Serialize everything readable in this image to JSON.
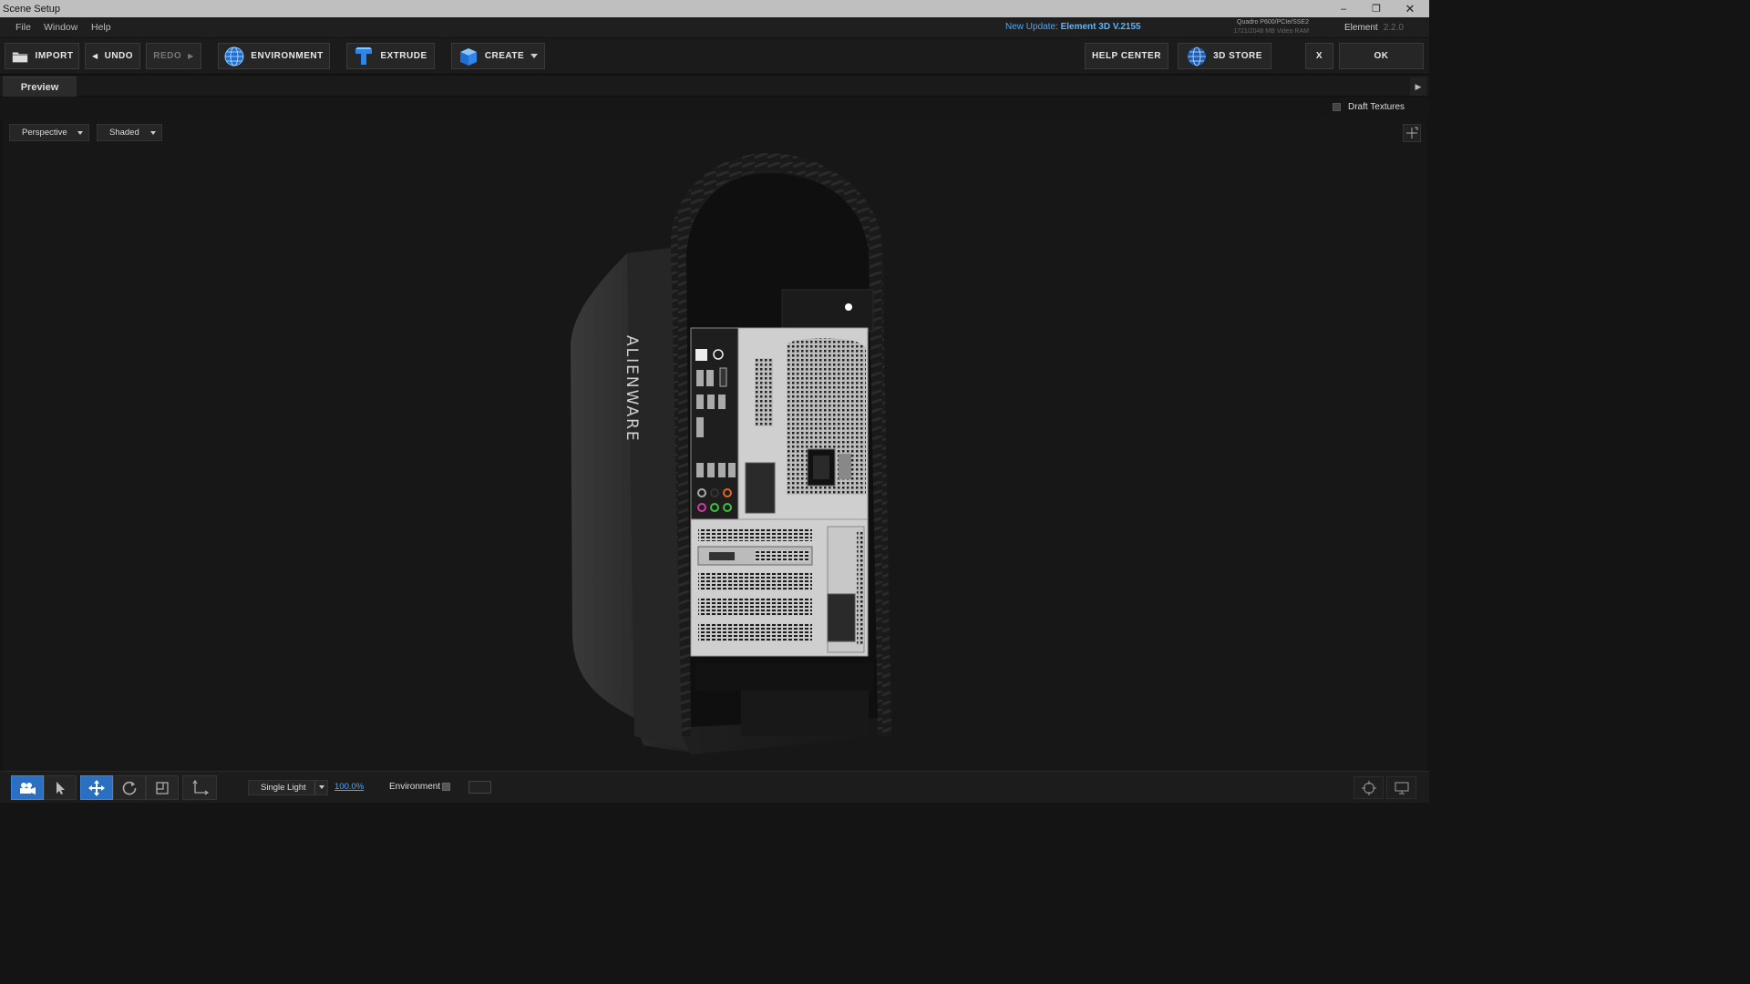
{
  "window": {
    "title": "Scene Setup",
    "controls": {
      "minimize": "–",
      "restore": "❐",
      "close": "✕"
    }
  },
  "menu": {
    "file": "File",
    "window": "Window",
    "help": "Help"
  },
  "update": {
    "prefix": "New Update:",
    "version": "Element 3D V.2155"
  },
  "gpu": {
    "line1": "Quadro P600/PCIe/SSE2",
    "line2": "1721/2048 MB Video RAM"
  },
  "product": {
    "name": "Element",
    "version": "2.2.0"
  },
  "toolbar": {
    "import": "IMPORT",
    "undo": "UNDO",
    "redo": "REDO",
    "environment": "ENVIRONMENT",
    "extrude": "EXTRUDE",
    "create": "CREATE",
    "help_center": "HELP CENTER",
    "store": "3D STORE",
    "cancel": "X",
    "ok": "OK"
  },
  "tabs": {
    "preview": "Preview"
  },
  "draft_textures": {
    "label": "Draft Textures",
    "checked": false
  },
  "viewport": {
    "camera_mode": "Perspective",
    "shading_mode": "Shaded",
    "model_label": "ALIENWARE"
  },
  "bottom": {
    "light_mode": "Single Light",
    "light_intensity": "100.0%",
    "environment_label": "Environment",
    "environment_checked": false,
    "active_tool": "move"
  },
  "colors": {
    "accent": "#2a6fc2",
    "link": "#49a6ff",
    "titlebar": "#bfbfbf",
    "background": "#141414"
  },
  "icons": {
    "import": "folder-icon",
    "environment": "globe-icon",
    "extrude": "extrude-T-icon",
    "create": "cube-icon",
    "store": "globe-icon",
    "tools": [
      "camera-icon",
      "pointer-icon",
      "move-icon",
      "rotate-icon",
      "scale-icon",
      "axis-icon"
    ],
    "right": [
      "target-icon",
      "monitor-icon"
    ]
  }
}
